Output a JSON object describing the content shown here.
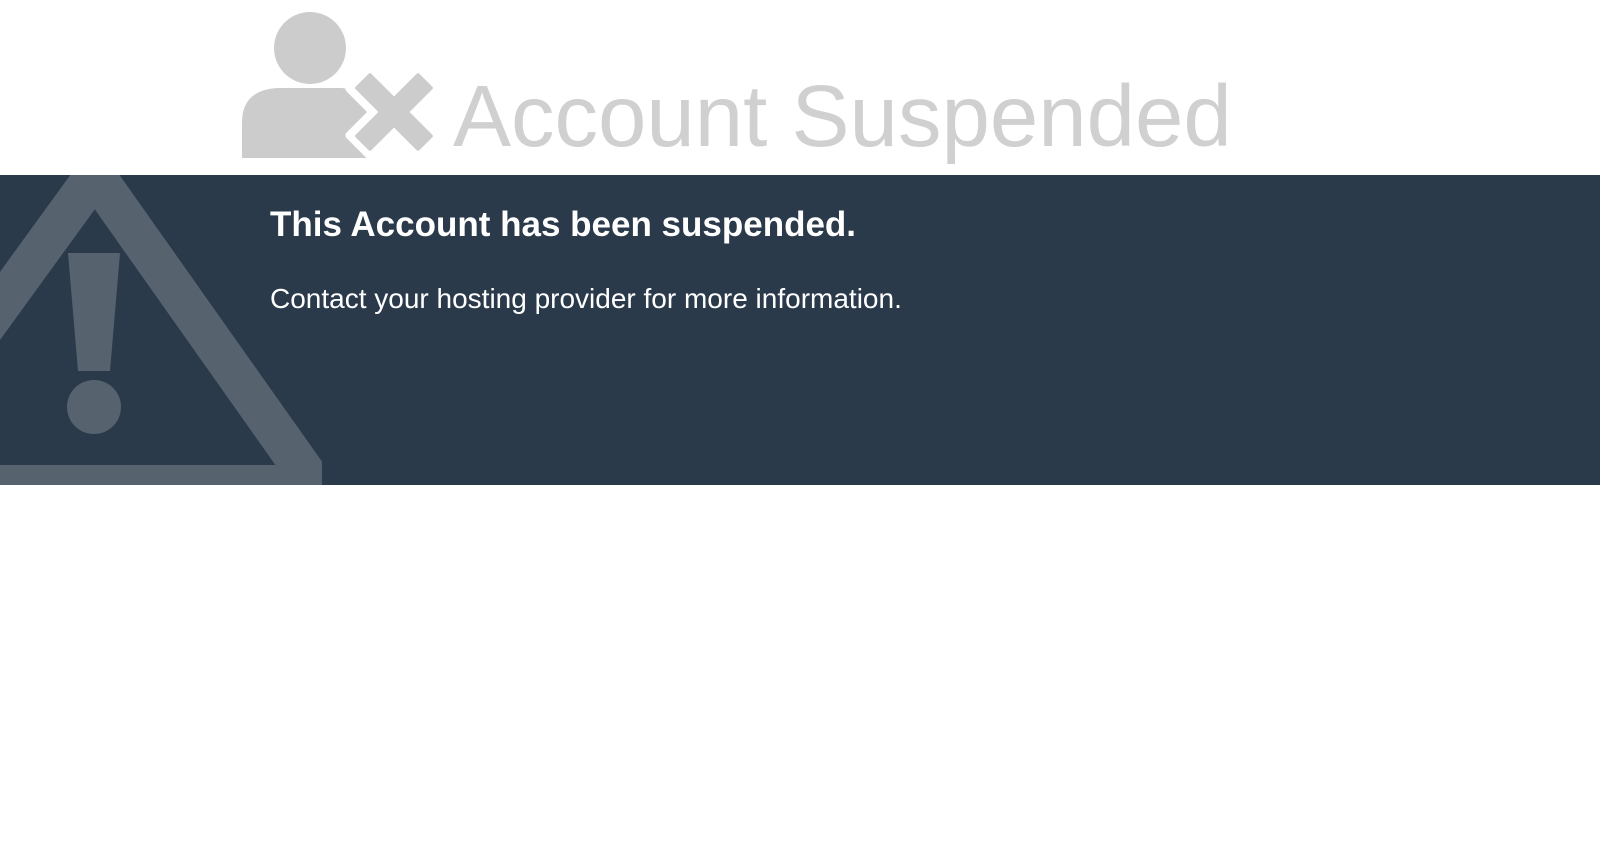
{
  "header": {
    "title": "Account Suspended",
    "icon": "user-x-icon"
  },
  "banner": {
    "heading": "This Account has been suspended.",
    "message": "Contact your hosting provider for more information.",
    "icon": "warning-triangle-icon"
  },
  "colors": {
    "banner_background": "#2a3a4b",
    "title_text": "#d0d0d0",
    "icon_gray": "#cccccc",
    "banner_icon": "#56636f",
    "banner_text": "#ffffff"
  }
}
